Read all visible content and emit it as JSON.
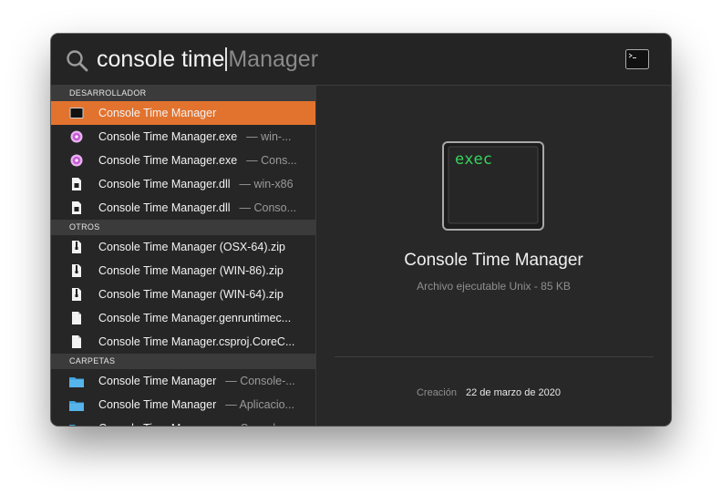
{
  "search": {
    "typed": "console time",
    "suggestion": "Manager"
  },
  "sections": [
    {
      "header": "DESARROLLADOR",
      "items": [
        {
          "title": "Console Time Manager",
          "subtitle": "",
          "icon": "terminal-exec-icon",
          "selected": true
        },
        {
          "title": "Console Time Manager.exe",
          "subtitle": "— win-...",
          "icon": "exe-file-icon",
          "selected": false
        },
        {
          "title": "Console Time Manager.exe",
          "subtitle": "— Cons...",
          "icon": "exe-file-icon",
          "selected": false
        },
        {
          "title": "Console Time Manager.dll",
          "subtitle": "— win-x86",
          "icon": "dll-file-icon",
          "selected": false
        },
        {
          "title": "Console Time Manager.dll",
          "subtitle": "— Conso...",
          "icon": "dll-file-icon",
          "selected": false
        }
      ]
    },
    {
      "header": "OTROS",
      "items": [
        {
          "title": "Console Time Manager (OSX-64).zip",
          "subtitle": "",
          "icon": "zip-file-icon",
          "selected": false
        },
        {
          "title": "Console Time Manager (WIN-86).zip",
          "subtitle": "",
          "icon": "zip-file-icon",
          "selected": false
        },
        {
          "title": "Console Time Manager (WIN-64).zip",
          "subtitle": "",
          "icon": "zip-file-icon",
          "selected": false
        },
        {
          "title": "Console Time Manager.genruntimec...",
          "subtitle": "",
          "icon": "document-icon",
          "selected": false
        },
        {
          "title": "Console Time Manager.csproj.CoreC...",
          "subtitle": "",
          "icon": "document-icon",
          "selected": false
        }
      ]
    },
    {
      "header": "CARPETAS",
      "items": [
        {
          "title": "Console Time Manager",
          "subtitle": "— Console-...",
          "icon": "folder-icon",
          "selected": false
        },
        {
          "title": "Console Time Manager",
          "subtitle": "— Aplicacio...",
          "icon": "folder-icon",
          "selected": false
        },
        {
          "title": "Console Time Manager",
          "subtitle": "— Console...",
          "icon": "folder-icon",
          "selected": false
        }
      ]
    }
  ],
  "preview": {
    "icon_text": "exec",
    "title": "Console Time Manager",
    "subtitle": "Archivo ejecutable Unix - 85 KB",
    "meta_label": "Creación",
    "meta_value": "22 de marzo de 2020"
  },
  "colors": {
    "selection": "#e2732f",
    "exec_text": "#37d35a",
    "folder": "#3fa2dc",
    "exe_icon": "#c85bd8"
  }
}
